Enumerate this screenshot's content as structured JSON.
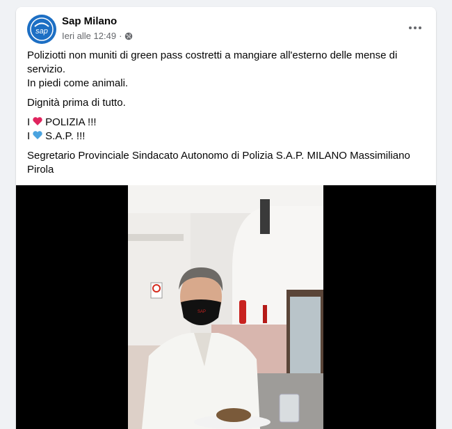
{
  "post": {
    "author": "Sap Milano",
    "time": "Ieri alle 12:49",
    "separator": "·",
    "avatar_text": "sap",
    "line1a": "Poliziotti non muniti di green pass costretti a mangiare all'esterno delle mense di servizio.",
    "line1b": "In piedi come animali.",
    "line2": "Dignità prima di tutto.",
    "line3_prefix": "I",
    "line3_text": "POLIZIA  !!!",
    "line4_prefix": "I",
    "line4_text": "S.A.P.  !!!",
    "line5": "Segretario Provinciale Sindacato Autonomo di Polizia S.A.P.  MILANO Massimiliano Pirola"
  },
  "icons": {
    "globe": "globe-icon",
    "more": "more-options-icon",
    "heart_red": "red-heart-icon",
    "heart_blue": "blue-heart-icon"
  },
  "colors": {
    "background": "#f0f2f5",
    "card": "#ffffff",
    "secondary_text": "#65676b",
    "avatar": "#1d6fc4",
    "heart_red": "#e0245e",
    "heart_blue": "#4aa3df"
  }
}
